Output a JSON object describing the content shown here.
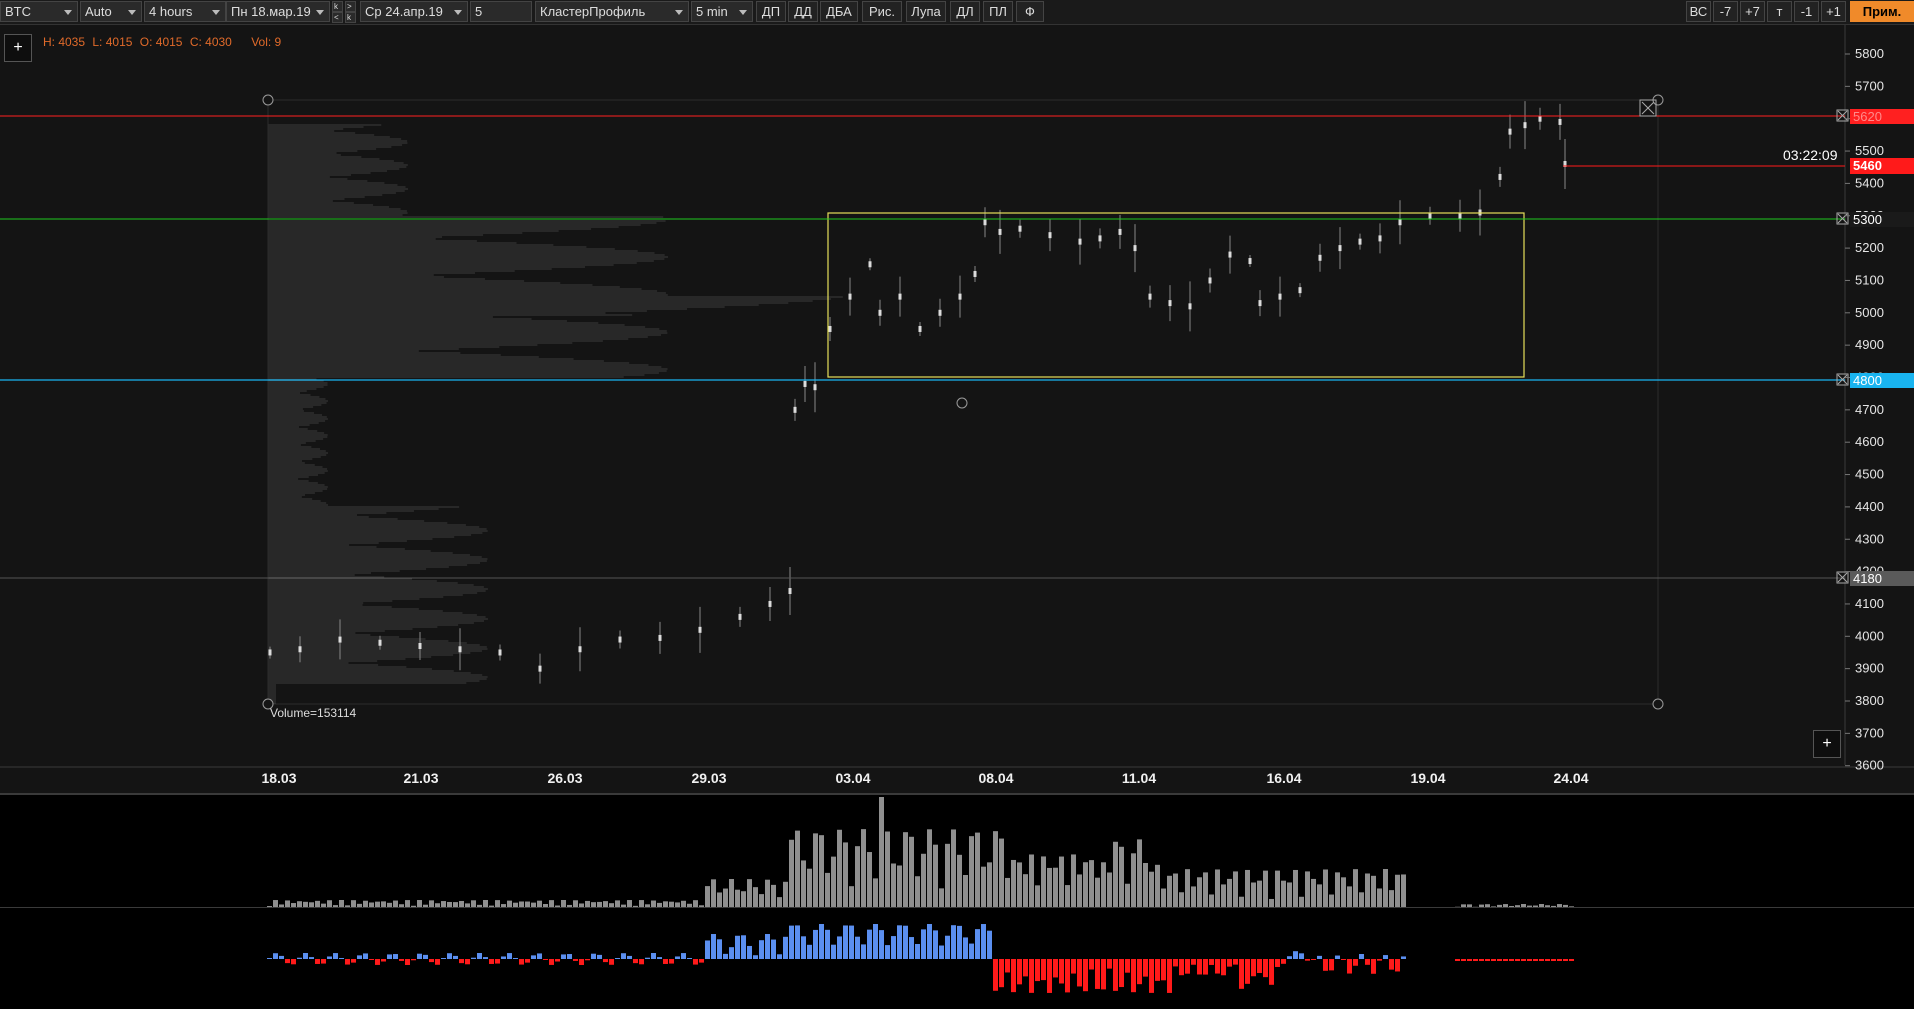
{
  "toolbar": {
    "symbol": "BTC",
    "scale_mode": "Auto",
    "period": "4 hours",
    "date_from": "Пн 18.мар.19",
    "date_to": "Ср 24.апр.19",
    "nav_k1": "k",
    "nav_k2": "k",
    "nav_lt": "<",
    "nav_gt": ">",
    "count": "5",
    "profile_type": "КластерПрофиль",
    "profile_tf": "5 min",
    "buttons": [
      "ДП",
      "ДД",
      "ДБА",
      "Рис.",
      "Лупа",
      "ДЛ",
      "ПЛ",
      "Ф"
    ],
    "right_buttons": [
      "ВС",
      "-7",
      "+7",
      "т",
      "-1",
      "+1"
    ],
    "apply_label": "Прим."
  },
  "info": {
    "high": "H: 4035",
    "low": "L: 4015",
    "open": "O: 4015",
    "close": "C: 4030",
    "volume": "Vol: 9"
  },
  "chart": {
    "price_ticks": [
      "5800",
      "5700",
      "5600",
      "5500",
      "5400",
      "5300",
      "5200",
      "5100",
      "5000",
      "4900",
      "4800",
      "4700",
      "4600",
      "4500",
      "4400",
      "4300",
      "4200",
      "4100",
      "4000",
      "3900",
      "3800",
      "3700",
      "3600"
    ],
    "date_ticks": [
      "18.03",
      "21.03",
      "26.03",
      "29.03",
      "03.04",
      "08.04",
      "11.04",
      "16.04",
      "19.04",
      "24.04"
    ],
    "countdown": "03:22:09",
    "profile_label": "Volume=153114",
    "levels": [
      {
        "label": "5620",
        "color": "#ff2020"
      },
      {
        "label": "5300",
        "color": "#1ec81e"
      },
      {
        "label": "4800",
        "color": "#19b4f0"
      },
      {
        "label": "4180",
        "color": "#8c8c8c"
      }
    ],
    "last_price": {
      "label": "5460",
      "color": "#ff1a1a"
    },
    "accent_box_color": "#e6e05a",
    "add_label": "+"
  },
  "indicators": {
    "volume_color": "#8f8f8f",
    "delta_positive_color": "#5b8ff0",
    "delta_negative_color": "#ff1a1a"
  }
}
